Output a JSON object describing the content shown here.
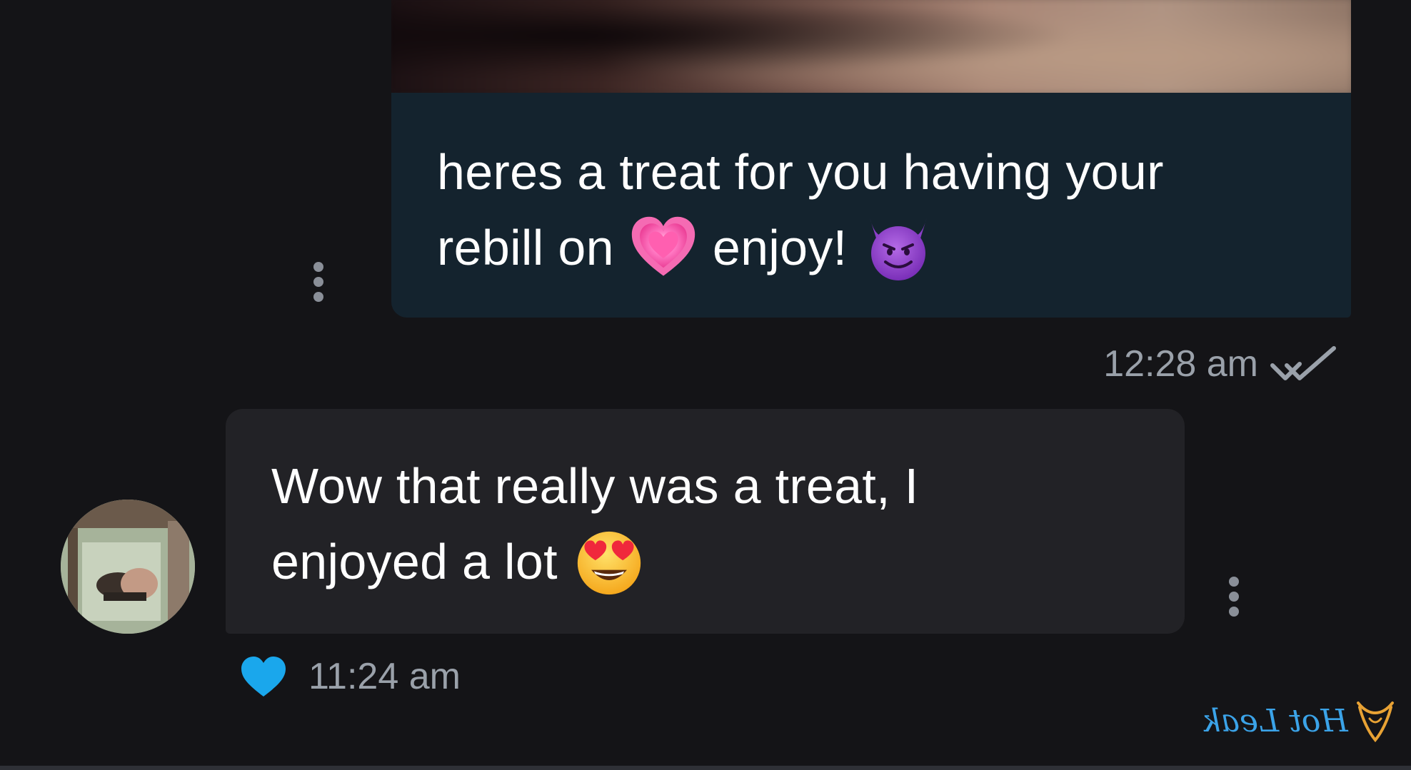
{
  "sent_message": {
    "text_line1": "heres a treat for you having your",
    "text_line2_a": "rebill on",
    "text_line2_b": "enjoy!",
    "emoji_1": "growing-heart",
    "emoji_2": "smiling-devil",
    "time": "12:28 am",
    "status_icon": "double-check-icon",
    "media_state": "blurred-preview"
  },
  "received_message": {
    "text_line1": "Wow that really was a treat, I",
    "text_line2": "enjoyed a lot",
    "emoji_1": "heart-eyes",
    "time": "11:24 am",
    "liked": true,
    "like_icon": "heart-icon"
  },
  "watermark": {
    "text": "Hot Leak",
    "logo_icon": "hotleak-logo-icon"
  },
  "colors": {
    "background": "#141417",
    "sent_bubble": "#14232e",
    "received_bubble": "#222226",
    "text": "#ffffff",
    "meta_text": "#9aa1aa",
    "like_heart": "#1aa7ec",
    "watermark": "#3ba3e8"
  }
}
